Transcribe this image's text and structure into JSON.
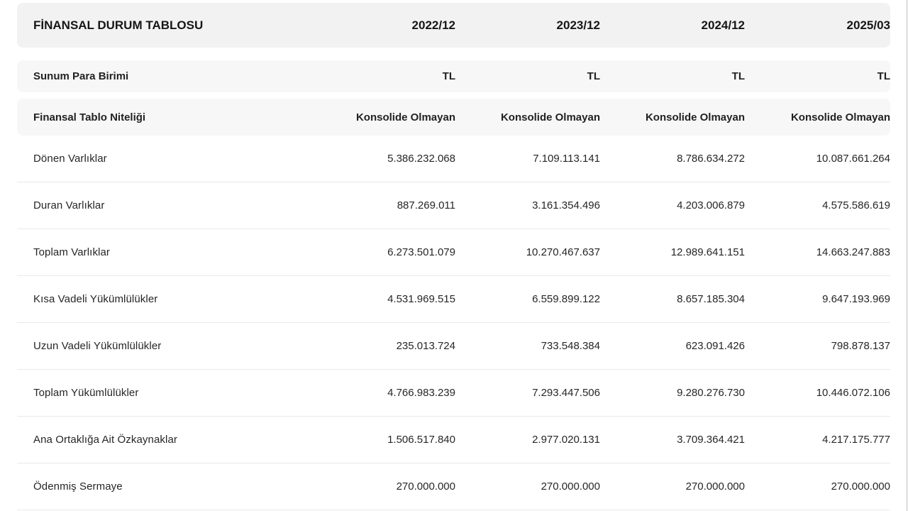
{
  "header": {
    "title": "FİNANSAL DURUM TABLOSU",
    "periods": [
      "2022/12",
      "2023/12",
      "2024/12",
      "2025/03"
    ]
  },
  "currency_row": {
    "label": "Sunum Para Birimi",
    "values": [
      "TL",
      "TL",
      "TL",
      "TL"
    ]
  },
  "nature_row": {
    "label": "Finansal Tablo Niteliği",
    "values": [
      "Konsolide Olmayan",
      "Konsolide Olmayan",
      "Konsolide Olmayan",
      "Konsolide Olmayan"
    ]
  },
  "rows": [
    {
      "label": "Dönen Varlıklar",
      "values": [
        "5.386.232.068",
        "7.109.113.141",
        "8.786.634.272",
        "10.087.661.264"
      ]
    },
    {
      "label": "Duran Varlıklar",
      "values": [
        "887.269.011",
        "3.161.354.496",
        "4.203.006.879",
        "4.575.586.619"
      ]
    },
    {
      "label": "Toplam Varlıklar",
      "values": [
        "6.273.501.079",
        "10.270.467.637",
        "12.989.641.151",
        "14.663.247.883"
      ]
    },
    {
      "label": "Kısa Vadeli Yükümlülükler",
      "values": [
        "4.531.969.515",
        "6.559.899.122",
        "8.657.185.304",
        "9.647.193.969"
      ]
    },
    {
      "label": "Uzun Vadeli Yükümlülükler",
      "values": [
        "235.013.724",
        "733.548.384",
        "623.091.426",
        "798.878.137"
      ]
    },
    {
      "label": "Toplam Yükümlülükler",
      "values": [
        "4.766.983.239",
        "7.293.447.506",
        "9.280.276.730",
        "10.446.072.106"
      ]
    },
    {
      "label": "Ana Ortaklığa Ait Özkaynaklar",
      "values": [
        "1.506.517.840",
        "2.977.020.131",
        "3.709.364.421",
        "4.217.175.777"
      ]
    },
    {
      "label": "Ödenmiş Sermaye",
      "values": [
        "270.000.000",
        "270.000.000",
        "270.000.000",
        "270.000.000"
      ]
    }
  ]
}
